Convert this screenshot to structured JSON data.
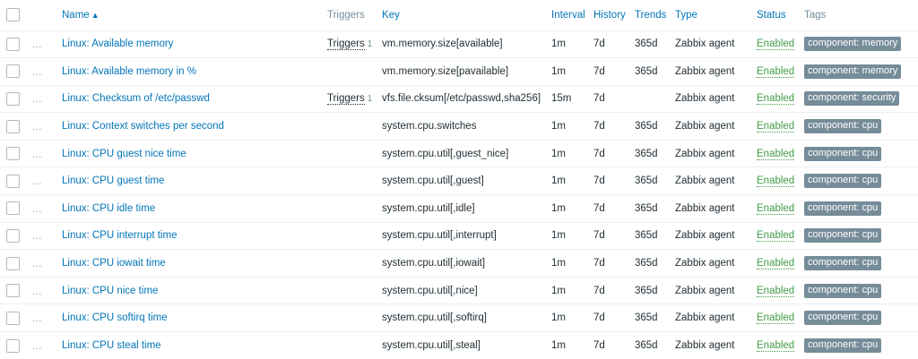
{
  "header": {
    "name": "Name",
    "sort_arrow": "▲",
    "triggers": "Triggers",
    "key": "Key",
    "interval": "Interval",
    "history": "History",
    "trends": "Trends",
    "type": "Type",
    "status": "Status",
    "tags": "Tags"
  },
  "row_menu_icon": "…",
  "rows": [
    {
      "name": "Linux: Available memory",
      "triggers": "Triggers",
      "triggers_count": "1",
      "key": "vm.memory.size[available]",
      "interval": "1m",
      "history": "7d",
      "trends": "365d",
      "type": "Zabbix agent",
      "status": "Enabled",
      "tag": "component: memory"
    },
    {
      "name": "Linux: Available memory in %",
      "triggers": "",
      "triggers_count": "",
      "key": "vm.memory.size[pavailable]",
      "interval": "1m",
      "history": "7d",
      "trends": "365d",
      "type": "Zabbix agent",
      "status": "Enabled",
      "tag": "component: memory"
    },
    {
      "name": "Linux: Checksum of /etc/passwd",
      "triggers": "Triggers",
      "triggers_count": "1",
      "key": "vfs.file.cksum[/etc/passwd,sha256]",
      "interval": "15m",
      "history": "7d",
      "trends": "",
      "type": "Zabbix agent",
      "status": "Enabled",
      "tag": "component: security"
    },
    {
      "name": "Linux: Context switches per second",
      "triggers": "",
      "triggers_count": "",
      "key": "system.cpu.switches",
      "interval": "1m",
      "history": "7d",
      "trends": "365d",
      "type": "Zabbix agent",
      "status": "Enabled",
      "tag": "component: cpu"
    },
    {
      "name": "Linux: CPU guest nice time",
      "triggers": "",
      "triggers_count": "",
      "key": "system.cpu.util[,guest_nice]",
      "interval": "1m",
      "history": "7d",
      "trends": "365d",
      "type": "Zabbix agent",
      "status": "Enabled",
      "tag": "component: cpu"
    },
    {
      "name": "Linux: CPU guest time",
      "triggers": "",
      "triggers_count": "",
      "key": "system.cpu.util[,guest]",
      "interval": "1m",
      "history": "7d",
      "trends": "365d",
      "type": "Zabbix agent",
      "status": "Enabled",
      "tag": "component: cpu"
    },
    {
      "name": "Linux: CPU idle time",
      "triggers": "",
      "triggers_count": "",
      "key": "system.cpu.util[,idle]",
      "interval": "1m",
      "history": "7d",
      "trends": "365d",
      "type": "Zabbix agent",
      "status": "Enabled",
      "tag": "component: cpu"
    },
    {
      "name": "Linux: CPU interrupt time",
      "triggers": "",
      "triggers_count": "",
      "key": "system.cpu.util[,interrupt]",
      "interval": "1m",
      "history": "7d",
      "trends": "365d",
      "type": "Zabbix agent",
      "status": "Enabled",
      "tag": "component: cpu"
    },
    {
      "name": "Linux: CPU iowait time",
      "triggers": "",
      "triggers_count": "",
      "key": "system.cpu.util[,iowait]",
      "interval": "1m",
      "history": "7d",
      "trends": "365d",
      "type": "Zabbix agent",
      "status": "Enabled",
      "tag": "component: cpu"
    },
    {
      "name": "Linux: CPU nice time",
      "triggers": "",
      "triggers_count": "",
      "key": "system.cpu.util[,nice]",
      "interval": "1m",
      "history": "7d",
      "trends": "365d",
      "type": "Zabbix agent",
      "status": "Enabled",
      "tag": "component: cpu"
    },
    {
      "name": "Linux: CPU softirq time",
      "triggers": "",
      "triggers_count": "",
      "key": "system.cpu.util[,softirq]",
      "interval": "1m",
      "history": "7d",
      "trends": "365d",
      "type": "Zabbix agent",
      "status": "Enabled",
      "tag": "component: cpu"
    },
    {
      "name": "Linux: CPU steal time",
      "triggers": "",
      "triggers_count": "",
      "key": "system.cpu.util[,steal]",
      "interval": "1m",
      "history": "7d",
      "trends": "365d",
      "type": "Zabbix agent",
      "status": "Enabled",
      "tag": "component: cpu"
    }
  ],
  "colors": {
    "link": "#0275b8",
    "enabled": "#429e47",
    "tag_bg": "#768d99",
    "muted_header": "#768d99"
  }
}
